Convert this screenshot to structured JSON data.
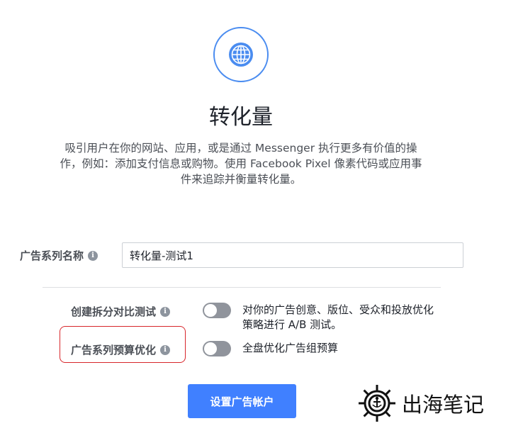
{
  "objective": {
    "icon": "globe-icon",
    "title": "转化量",
    "description_lines": [
      "吸引用户在你的网站、应用，或是通过 Messenger 执行更多有价值的操",
      "作，例如：添加支付信息或购物。使用 Facebook Pixel 像素代码或应用事",
      "件来追踪并衡量转化量。"
    ]
  },
  "campaign_name": {
    "label": "广告系列名称",
    "value": "转化量-测试1"
  },
  "split_test": {
    "label": "创建拆分对比测试",
    "enabled": false,
    "description_lines": [
      "对你的广告创意、版位、受众和投放优化",
      "策略进行 A/B 测试。"
    ]
  },
  "budget_optimization": {
    "label": "广告系列预算优化",
    "enabled": false,
    "description": "全盘优化广告组预算",
    "highlight_color": "#d8262b"
  },
  "setup_button": {
    "label": "设置广告帐户"
  },
  "watermark": {
    "text": "出海笔记",
    "icon": "ship-wheel-icon"
  },
  "colors": {
    "accent": "#4080ff",
    "toggle_off": "#90949c"
  }
}
